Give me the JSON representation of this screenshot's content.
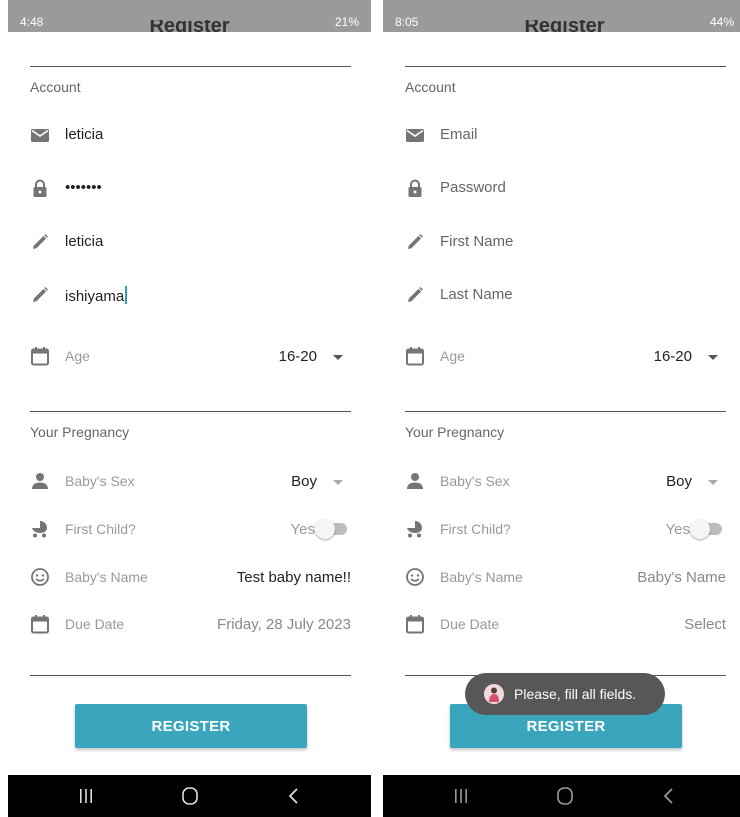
{
  "colors": {
    "accent": "#3aa6bd",
    "status_bar": "#9a9a9a",
    "nav_bar": "#000000",
    "toast_bg": "#575757"
  },
  "left": {
    "status": {
      "time": "4:48",
      "battery": "21%"
    },
    "title": "Register",
    "account_title": "Account",
    "email": {
      "value": "leticia",
      "icon": "envelope-icon"
    },
    "password": {
      "value": "•••••••",
      "icon": "lock-icon"
    },
    "first_name": {
      "value": "leticia",
      "icon": "pencil-icon"
    },
    "last_name": {
      "value": "ishiyama",
      "icon": "pencil-icon"
    },
    "age": {
      "label": "Age",
      "selected": "16-20",
      "icon": "calendar-icon"
    },
    "pregnancy_title": "Your Pregnancy",
    "baby_sex": {
      "label": "Baby's Sex",
      "selected": "Boy",
      "icon": "person-icon"
    },
    "first_child": {
      "label": "First Child?",
      "toggle_text": "Yes",
      "checked": false,
      "icon": "stroller-icon"
    },
    "baby_name": {
      "label": "Baby's Name",
      "value": "Test baby name!!",
      "icon": "smiley-icon"
    },
    "due_date": {
      "label": "Due Date",
      "value": "Friday, 28 July 2023",
      "icon": "calendar-icon"
    },
    "register_label": "REGISTER"
  },
  "right": {
    "status": {
      "time": "8:05",
      "battery": "44%"
    },
    "title": "Register",
    "account_title": "Account",
    "email": {
      "placeholder": "Email",
      "icon": "envelope-icon"
    },
    "password": {
      "placeholder": "Password",
      "icon": "lock-icon"
    },
    "first_name": {
      "placeholder": "First Name",
      "icon": "pencil-icon"
    },
    "last_name": {
      "placeholder": "Last Name",
      "icon": "pencil-icon"
    },
    "age": {
      "label": "Age",
      "selected": "16-20",
      "icon": "calendar-icon"
    },
    "pregnancy_title": "Your Pregnancy",
    "baby_sex": {
      "label": "Baby's Sex",
      "selected": "Boy",
      "icon": "person-icon"
    },
    "first_child": {
      "label": "First Child?",
      "toggle_text": "Yes",
      "checked": false,
      "icon": "stroller-icon"
    },
    "baby_name": {
      "label": "Baby's Name",
      "value": "Baby's Name",
      "icon": "smiley-icon"
    },
    "due_date": {
      "label": "Due Date",
      "value": "Select",
      "icon": "calendar-icon"
    },
    "register_label": "REGISTER",
    "toast": {
      "text": "Please, fill all fields.",
      "icon": "app-avatar-icon"
    }
  }
}
